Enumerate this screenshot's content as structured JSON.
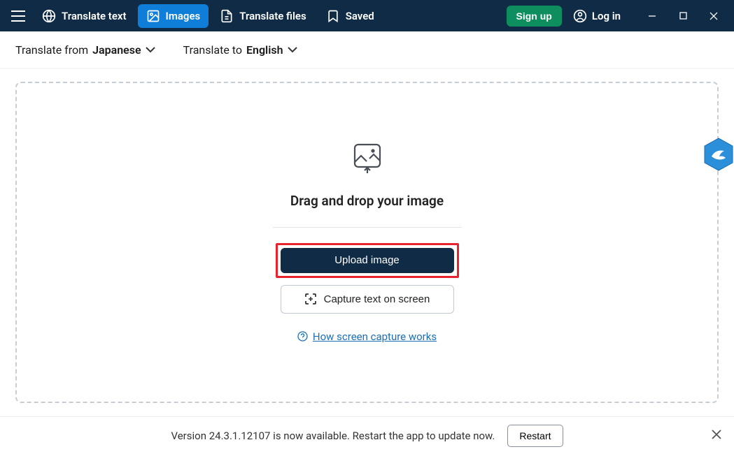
{
  "nav": {
    "translate_text": "Translate text",
    "images": "Images",
    "translate_files": "Translate files",
    "saved": "Saved"
  },
  "auth": {
    "signup": "Sign up",
    "login": "Log in"
  },
  "lang": {
    "from_label": "Translate from",
    "from_value": "Japanese",
    "to_label": "Translate to",
    "to_value": "English"
  },
  "dropzone": {
    "heading": "Drag and drop your image",
    "upload_button": "Upload image",
    "capture_button": "Capture text on screen",
    "help_link": "How screen capture works"
  },
  "update": {
    "message": "Version 24.3.1.12107 is now available. Restart the app to update now.",
    "restart": "Restart"
  }
}
